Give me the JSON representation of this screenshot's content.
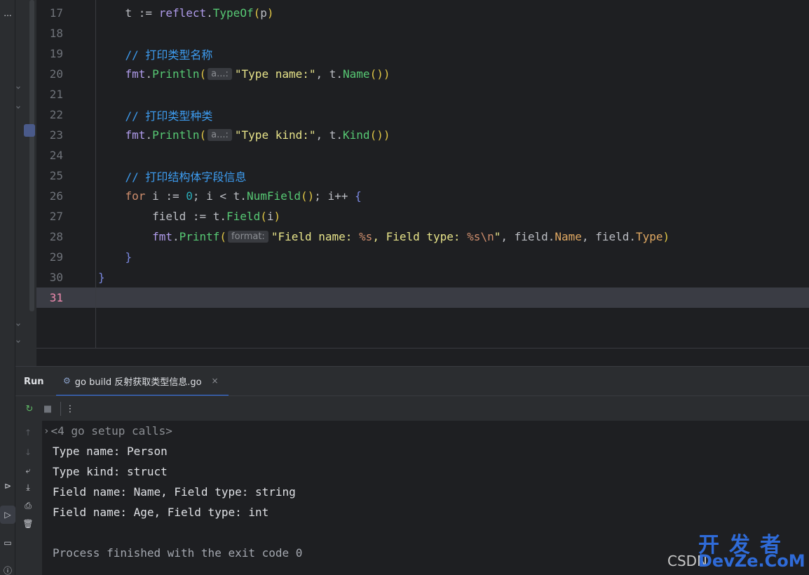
{
  "editor": {
    "lines": [
      {
        "n": "17",
        "tokens": [
          {
            "t": "    t := ",
            "c": "t-def"
          },
          {
            "t": "reflect",
            "c": "t-pkg"
          },
          {
            "t": ".",
            "c": "t-def"
          },
          {
            "t": "TypeOf",
            "c": "t-fng"
          },
          {
            "t": "(",
            "c": "t-paren1"
          },
          {
            "t": "p",
            "c": "t-def"
          },
          {
            "t": ")",
            "c": "t-paren1"
          }
        ]
      },
      {
        "n": "18",
        "tokens": []
      },
      {
        "n": "19",
        "tokens": [
          {
            "t": "    // 打印类型名称",
            "c": "t-cmt"
          }
        ]
      },
      {
        "n": "20",
        "tokens": [
          {
            "t": "    fmt",
            "c": "t-pkg"
          },
          {
            "t": ".",
            "c": "t-def"
          },
          {
            "t": "Println",
            "c": "t-fng"
          },
          {
            "t": "(",
            "c": "t-paren1"
          },
          {
            "hint": "a...:"
          },
          {
            "t": "\"Type name:\"",
            "c": "t-str"
          },
          {
            "t": ", t.",
            "c": "t-def"
          },
          {
            "t": "Name",
            "c": "t-fng"
          },
          {
            "t": "())",
            "c": "t-paren1"
          }
        ]
      },
      {
        "n": "21",
        "tokens": []
      },
      {
        "n": "22",
        "tokens": [
          {
            "t": "    // 打印类型种类",
            "c": "t-cmt"
          }
        ]
      },
      {
        "n": "23",
        "tokens": [
          {
            "t": "    fmt",
            "c": "t-pkg"
          },
          {
            "t": ".",
            "c": "t-def"
          },
          {
            "t": "Println",
            "c": "t-fng"
          },
          {
            "t": "(",
            "c": "t-paren1"
          },
          {
            "hint": "a...:"
          },
          {
            "t": "\"Type kind:\"",
            "c": "t-str"
          },
          {
            "t": ", t.",
            "c": "t-def"
          },
          {
            "t": "Kind",
            "c": "t-fng"
          },
          {
            "t": "())",
            "c": "t-paren1"
          }
        ]
      },
      {
        "n": "24",
        "tokens": []
      },
      {
        "n": "25",
        "tokens": [
          {
            "t": "    // 打印结构体字段信息",
            "c": "t-cmt"
          }
        ]
      },
      {
        "n": "26",
        "tokens": [
          {
            "t": "    for",
            "c": "t-kw"
          },
          {
            "t": " i := ",
            "c": "t-def"
          },
          {
            "t": "0",
            "c": "t-num"
          },
          {
            "t": "; i < t.",
            "c": "t-def"
          },
          {
            "t": "NumField",
            "c": "t-fng"
          },
          {
            "t": "()",
            "c": "t-paren1"
          },
          {
            "t": "; i++ ",
            "c": "t-def"
          },
          {
            "t": "{",
            "c": "t-brace"
          }
        ]
      },
      {
        "n": "27",
        "tokens": [
          {
            "t": "        field := t.",
            "c": "t-def"
          },
          {
            "t": "Field",
            "c": "t-fng"
          },
          {
            "t": "(",
            "c": "t-paren1"
          },
          {
            "t": "i",
            "c": "t-def"
          },
          {
            "t": ")",
            "c": "t-paren1"
          }
        ]
      },
      {
        "n": "28",
        "tokens": [
          {
            "t": "        fmt",
            "c": "t-pkg"
          },
          {
            "t": ".",
            "c": "t-def"
          },
          {
            "t": "Printf",
            "c": "t-fng"
          },
          {
            "t": "(",
            "c": "t-paren1"
          },
          {
            "hint": "format:"
          },
          {
            "t": "\"Field name: ",
            "c": "t-str"
          },
          {
            "t": "%s",
            "c": "t-esc"
          },
          {
            "t": ", Field type: ",
            "c": "t-str"
          },
          {
            "t": "%s\\n",
            "c": "t-esc"
          },
          {
            "t": "\"",
            "c": "t-str"
          },
          {
            "t": ", field.",
            "c": "t-def"
          },
          {
            "t": "Name",
            "c": "t-orange"
          },
          {
            "t": ", field.",
            "c": "t-def"
          },
          {
            "t": "Type",
            "c": "t-orange"
          },
          {
            "t": ")",
            "c": "t-paren1"
          }
        ]
      },
      {
        "n": "29",
        "tokens": [
          {
            "t": "    }",
            "c": "t-brace"
          }
        ]
      },
      {
        "n": "30",
        "tokens": [
          {
            "t": "}",
            "c": "t-brace"
          }
        ]
      },
      {
        "n": "31",
        "tokens": [],
        "current": true
      }
    ]
  },
  "run_panel": {
    "title": "Run",
    "tab_label": "go build 反射获取类型信息.go",
    "tab_close": "×",
    "setup_calls": "<4 go setup calls>",
    "output": [
      "Type name: Person",
      "Type kind: struct",
      "Field name: Name, Field type: string",
      "Field name: Age, Field type: int",
      "",
      "Process finished with the exit code 0"
    ]
  },
  "watermark": {
    "logo_text": "开发者",
    "site_text": "DevZe.CoM",
    "csdn_text": "CSDN"
  },
  "toolstrip": {
    "more_label": "..."
  }
}
